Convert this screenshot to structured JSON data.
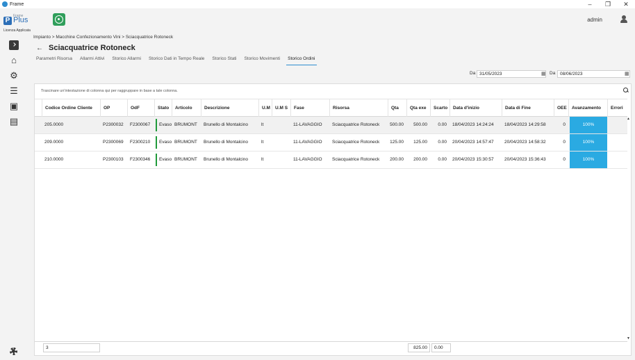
{
  "window": {
    "title": "Frame",
    "controls": [
      "–",
      "❐",
      "✕"
    ]
  },
  "header": {
    "logo_frame": "Frame",
    "logo_plus": "Plus",
    "logo_p": "P",
    "licenza": "Licenza Applicata",
    "user": "admin"
  },
  "breadcrumb": "Impianto > Macchine Confezionamento Vini > Sciacquatrice Rotoneck",
  "page_title": "Sciacquatrice Rotoneck",
  "tabs": [
    {
      "label": "Parametri Risorsa"
    },
    {
      "label": "Allarmi Attivi"
    },
    {
      "label": "Storico Allarmi"
    },
    {
      "label": "Storico Dati in Tempo Reale"
    },
    {
      "label": "Storico Stati"
    },
    {
      "label": "Storico Movimenti"
    },
    {
      "label": "Storico Ordini"
    }
  ],
  "active_tab_index": 6,
  "date_filter": {
    "from_label": "Da",
    "from_value": "31/05/2023",
    "to_label": "Da",
    "to_value": "08/06/2023"
  },
  "grid": {
    "group_hint": "Trascinare un'intestazione di colonna qui per raggruppare in base a tale colonna.",
    "columns": [
      "Codice Ordine Cliente",
      "OP",
      "OdF",
      "Stato",
      "Articolo",
      "Descrizione",
      "U.M",
      "U.M S",
      "Fase",
      "Risorsa",
      "Qta",
      "Qta exe",
      "Scarto",
      "Data d'inizio",
      "Data di Fine",
      "OEE",
      "Avanzamento",
      "Errori"
    ],
    "rows": [
      {
        "codice": "205.0000",
        "op": "P2300032",
        "odf": "F2300067",
        "stato": "Evaso",
        "articolo": "BRUMONT",
        "descrizione": "Brunello di Montalcino",
        "um": "lt",
        "ums": "",
        "fase": "11-LAVAGGIO",
        "risorsa": "Sciacquatrice Rotoneck",
        "qta": "500.00",
        "qta_exe": "500.00",
        "scarto": "0.00",
        "inizio": "18/04/2023 14:24:24",
        "fine": "18/04/2023 14:29:58",
        "oee": "0",
        "avanzamento": "100%",
        "avanzamento_value": 100,
        "errori": ""
      },
      {
        "codice": "209.0000",
        "op": "P2300069",
        "odf": "F2300210",
        "stato": "Evaso",
        "articolo": "BRUMONT",
        "descrizione": "Brunello di Montalcino",
        "um": "lt",
        "ums": "",
        "fase": "11-LAVAGGIO",
        "risorsa": "Sciacquatrice Rotoneck",
        "qta": "125.00",
        "qta_exe": "125.00",
        "scarto": "0.00",
        "inizio": "20/04/2023 14:57:47",
        "fine": "20/04/2023 14:58:32",
        "oee": "0",
        "avanzamento": "100%",
        "avanzamento_value": 100,
        "errori": ""
      },
      {
        "codice": "210.0000",
        "op": "P2300103",
        "odf": "F2300346",
        "stato": "Evaso",
        "articolo": "BRUMONT",
        "descrizione": "Brunello di Montalcino",
        "um": "lt",
        "ums": "",
        "fase": "11-LAVAGGIO",
        "risorsa": "Sciacquatrice Rotoneck",
        "qta": "200.00",
        "qta_exe": "200.00",
        "scarto": "0.00",
        "inizio": "20/04/2023 15:30:57",
        "fine": "20/04/2023 15:36:43",
        "oee": "0",
        "avanzamento": "100%",
        "avanzamento_value": 100,
        "errori": ""
      }
    ],
    "footer": {
      "count": "3",
      "qta_total": "825.00",
      "qta_exe_total": "0.00"
    }
  },
  "colors": {
    "accent": "#2d8ccf",
    "progress": "#2aaae2",
    "status_ok": "#1f9a3a",
    "brand": "#2d6fb7"
  },
  "icons": [
    "app-logo-icon",
    "app-module-icon",
    "user-icon",
    "expand-icon",
    "home-icon",
    "machine-icon",
    "list-icon",
    "box-icon",
    "document-icon",
    "settings-icon",
    "back-arrow-icon",
    "calendar-icon",
    "search-icon"
  ]
}
